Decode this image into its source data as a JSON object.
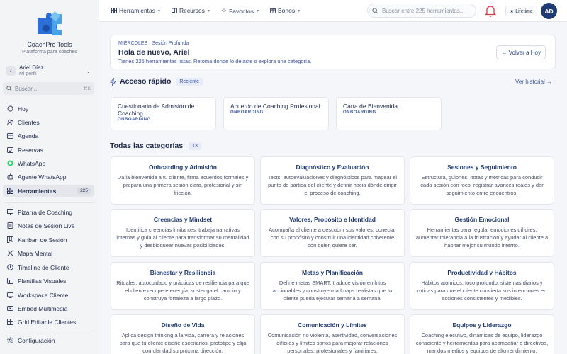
{
  "brand": {
    "title": "CoachPro Tools",
    "subtitle": "Plataforma para coaches"
  },
  "profile": {
    "initial": "7",
    "name": "Ariel Díaz",
    "role": "Mi perfil"
  },
  "sidebar_search": {
    "placeholder": "Buscar...",
    "shortcut": "⌘K"
  },
  "nav_primary": [
    {
      "label": "Hoy",
      "icon": "circle-icon"
    },
    {
      "label": "Clientes",
      "icon": "users-icon"
    },
    {
      "label": "Agenda",
      "icon": "calendar-icon"
    },
    {
      "label": "Reservas",
      "icon": "calendar-check-icon"
    },
    {
      "label": "WhatsApp",
      "icon": "whatsapp-icon"
    },
    {
      "label": "Agente WhatsApp",
      "icon": "bot-icon"
    },
    {
      "label": "Herramientas",
      "icon": "grid-icon",
      "count": "225",
      "active": true
    }
  ],
  "nav_tools": [
    {
      "label": "Pizarra de Coaching",
      "icon": "whiteboard-icon"
    },
    {
      "label": "Notas de Sesión Live",
      "icon": "notes-icon"
    },
    {
      "label": "Kanban de Sesión",
      "icon": "kanban-icon"
    },
    {
      "label": "Mapa Mental",
      "icon": "mindmap-icon"
    },
    {
      "label": "Timeline de Cliente",
      "icon": "timeline-icon"
    },
    {
      "label": "Plantillas Visuales",
      "icon": "template-icon"
    },
    {
      "label": "Workspace Cliente",
      "icon": "workspace-icon"
    },
    {
      "label": "Embed Multimedia",
      "icon": "embed-icon"
    },
    {
      "label": "Grid Editable Clientes",
      "icon": "table-icon"
    }
  ],
  "nav_settings": {
    "label": "Configuración",
    "icon": "gear-icon"
  },
  "topbar": {
    "menus": [
      {
        "label": "Herramientas",
        "icon": "grid-icon"
      },
      {
        "label": "Recursos",
        "icon": "book-icon"
      },
      {
        "label": "Favoritos",
        "icon": "star-icon"
      },
      {
        "label": "Bonos",
        "icon": "gift-icon"
      }
    ],
    "search_placeholder": "Buscar entre 225 herramientas...",
    "plan_badge": "★ Lifetime",
    "avatar_initials": "AD"
  },
  "welcome": {
    "day": "MIÉRCOLES · Sesión Profunda",
    "title": "Hola de nuevo, Ariel",
    "subtitle": "Tienes 225 herramientas listas. Retoma donde lo dejaste o explora una categoría.",
    "back_button": "← Volver a Hoy"
  },
  "quick_access": {
    "title": "Acceso rápido",
    "badge": "Reciente",
    "history_link": "Ver historial →",
    "items": [
      {
        "title": "Cuestionario de Admisión de Coaching",
        "tag": "ONBOARDING"
      },
      {
        "title": "Acuerdo de Coaching Profesional",
        "tag": "ONBOARDING"
      },
      {
        "title": "Carta de Bienvenida",
        "tag": "ONBOARDING"
      }
    ]
  },
  "categories": {
    "title": "Todas las categorías",
    "count": "13",
    "items": [
      {
        "title": "Onboarding y Admisión",
        "desc": "Da la bienvenida a tu cliente, firma acuerdos formales y prepara una primera sesión clara, profesional y sin fricción."
      },
      {
        "title": "Diagnóstico y Evaluación",
        "desc": "Tests, autoevaluaciones y diagnósticos para mapear el punto de partida del cliente y definir hacia dónde dirigir el proceso de coaching."
      },
      {
        "title": "Sesiones y Seguimiento",
        "desc": "Estructura, guiones, notas y métricas para conducir cada sesión con foco, registrar avances reales y dar seguimiento entre encuentros."
      },
      {
        "title": "Creencias y Mindset",
        "desc": "Identifica creencias limitantes, trabaja narrativas internas y guía al cliente para transformar su mentalidad y desbloquear nuevas posibilidades."
      },
      {
        "title": "Valores, Propósito e Identidad",
        "desc": "Acompaña al cliente a descubrir sus valores, conectar con su propósito y construir una identidad coherente con quien quiere ser."
      },
      {
        "title": "Gestión Emocional",
        "desc": "Herramientas para regular emociones difíciles, aumentar tolerancia a la frustración y ayudar al cliente a habitar mejor su mundo interno."
      },
      {
        "title": "Bienestar y Resiliencia",
        "desc": "Rituales, autocuidado y prácticas de resiliencia para que el cliente recupere energía, sostenga el cambio y construya fortaleza a largo plazo."
      },
      {
        "title": "Metas y Planificación",
        "desc": "Define metas SMART, traduce visión en hitos accionables y construye roadmaps realistas que tu cliente pueda ejecutar semana a semana."
      },
      {
        "title": "Productividad y Hábitos",
        "desc": "Hábitos atómicos, foco profundo, sistemas diarios y rutinas para que el cliente convierta sus intenciones en acciones consistentes y medibles."
      },
      {
        "title": "Diseño de Vida",
        "desc": "Aplica design thinking a la vida, carrera y relaciones para que tu cliente diseñe escenarios, prototipe y elija con claridad su próxima dirección."
      },
      {
        "title": "Comunicación y Límites",
        "desc": "Comunicación no violenta, asertividad, conversaciones difíciles y límites sanos para mejorar relaciones personales, profesionales y familiares."
      },
      {
        "title": "Equipos y Liderazgo",
        "desc": "Coaching ejecutivo, dinámicas de equipo, liderazgo consciente y herramientas para acompañar a directivos, mandos medios y equipos de alto rendimiento."
      }
    ]
  },
  "colors": {
    "primary": "#1f3a73",
    "accent": "#3b56a0",
    "whatsapp": "#25d366"
  }
}
